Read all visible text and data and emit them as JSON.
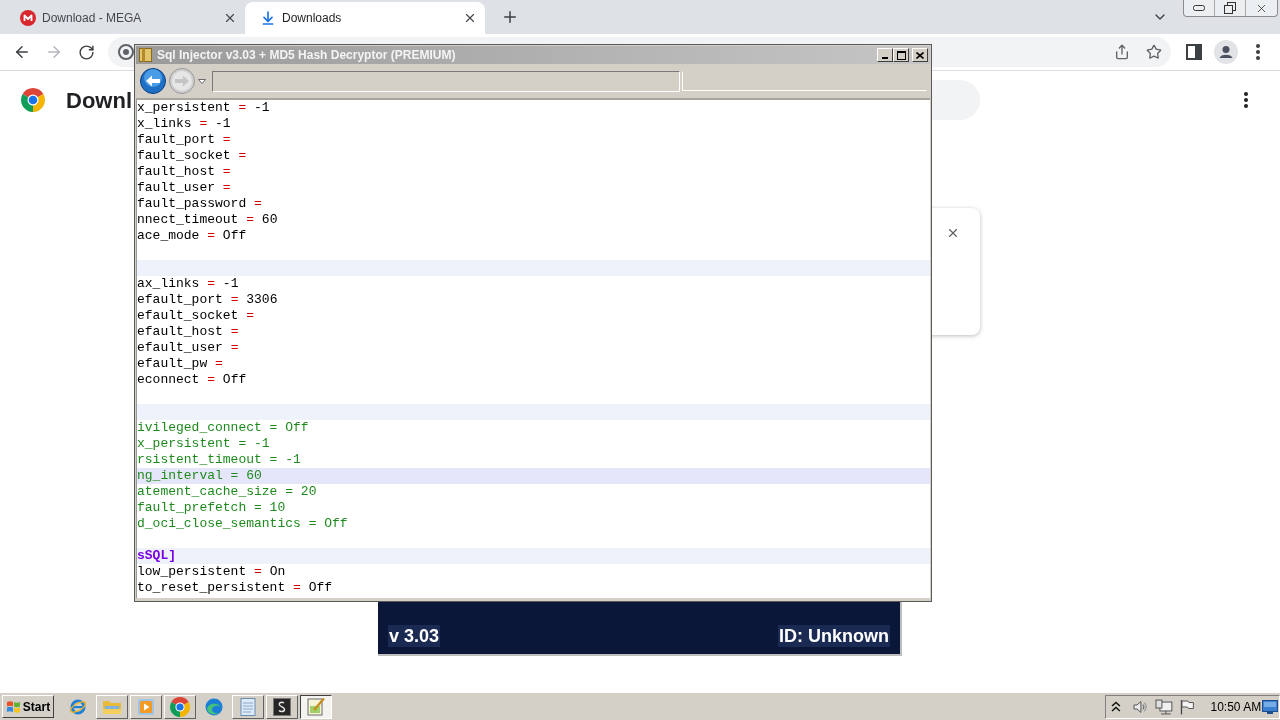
{
  "browser": {
    "tabs": [
      {
        "kind": "site",
        "title": "Download - MEGA",
        "selected": false
      },
      {
        "kind": "download",
        "title": "Downloads",
        "selected": true
      }
    ],
    "forward_disabled": true,
    "page": {
      "heading": "Downl"
    }
  },
  "dialog": {
    "title": "Sql Injector v3.03 + MD5 Hash Decryptor (PREMIUM)",
    "forward_disabled": true,
    "lines": [
      {
        "kind": "setting",
        "key": "x_persistent",
        "operator": "=",
        "value": "-1",
        "current": false
      },
      {
        "kind": "setting",
        "key": "x_links",
        "operator": "=",
        "value": "-1",
        "current": false
      },
      {
        "kind": "setting",
        "key": "fault_port",
        "operator": "=",
        "current": false
      },
      {
        "kind": "setting",
        "key": "fault_socket",
        "operator": "=",
        "current": false
      },
      {
        "kind": "setting",
        "key": "fault_host",
        "operator": "=",
        "current": false
      },
      {
        "kind": "setting",
        "key": "fault_user",
        "operator": "=",
        "current": false
      },
      {
        "kind": "setting",
        "key": "fault_password",
        "operator": "=",
        "current": false
      },
      {
        "kind": "setting",
        "key": "nnect_timeout",
        "operator": "=",
        "value": "60",
        "current": false
      },
      {
        "kind": "setting",
        "key": "ace_mode",
        "operator": "=",
        "value": "Off",
        "current": false
      },
      {
        "kind": "blank"
      },
      {
        "kind": "section",
        "current": false
      },
      {
        "kind": "setting",
        "key": "ax_links",
        "operator": "=",
        "value": "-1",
        "current": false
      },
      {
        "kind": "setting",
        "key": "efault_port",
        "operator": "=",
        "value": "3306",
        "current": false
      },
      {
        "kind": "setting",
        "key": "efault_socket",
        "operator": "=",
        "current": false
      },
      {
        "kind": "setting",
        "key": "efault_host",
        "operator": "=",
        "current": false
      },
      {
        "kind": "setting",
        "key": "efault_user",
        "operator": "=",
        "current": false
      },
      {
        "kind": "setting",
        "key": "efault_pw",
        "operator": "=",
        "current": false
      },
      {
        "kind": "setting",
        "key": "econnect",
        "operator": "=",
        "value": "Off",
        "current": false
      },
      {
        "kind": "blank"
      },
      {
        "kind": "section",
        "current": false
      },
      {
        "kind": "comment",
        "text": "ivileged_connect = Off",
        "current": false
      },
      {
        "kind": "comment",
        "text": "x_persistent = -1",
        "current": false
      },
      {
        "kind": "comment",
        "text": "rsistent_timeout = -1",
        "current": false
      },
      {
        "kind": "comment",
        "text": "ng_interval = 60",
        "current": true
      },
      {
        "kind": "comment",
        "text": "atement_cache_size = 20",
        "current": false
      },
      {
        "kind": "comment",
        "text": "fault_prefetch = 10",
        "current": false
      },
      {
        "kind": "comment",
        "text": "d_oci_close_semantics = Off",
        "current": false
      },
      {
        "kind": "blank"
      },
      {
        "kind": "section",
        "text": "sSQL]",
        "current": false
      },
      {
        "kind": "setting",
        "key": "low_persistent",
        "operator": "=",
        "value": "On",
        "current": false
      },
      {
        "kind": "setting",
        "key": "to_reset_persistent",
        "operator": "=",
        "value": "Off",
        "current": false
      }
    ]
  },
  "banner": {
    "version": "v 3.03",
    "id": "ID: Unknown"
  },
  "taskbar": {
    "start": "Start",
    "items": [
      {
        "kind": "pinned",
        "selected": false
      },
      {
        "kind": "running",
        "selected": false
      },
      {
        "kind": "running",
        "selected": false
      },
      {
        "kind": "running",
        "selected": false
      },
      {
        "kind": "pinned",
        "selected": false
      },
      {
        "kind": "running",
        "selected": false
      },
      {
        "kind": "running",
        "selected": false
      },
      {
        "kind": "running",
        "selected": true
      }
    ],
    "clock": "10:50 AM"
  }
}
